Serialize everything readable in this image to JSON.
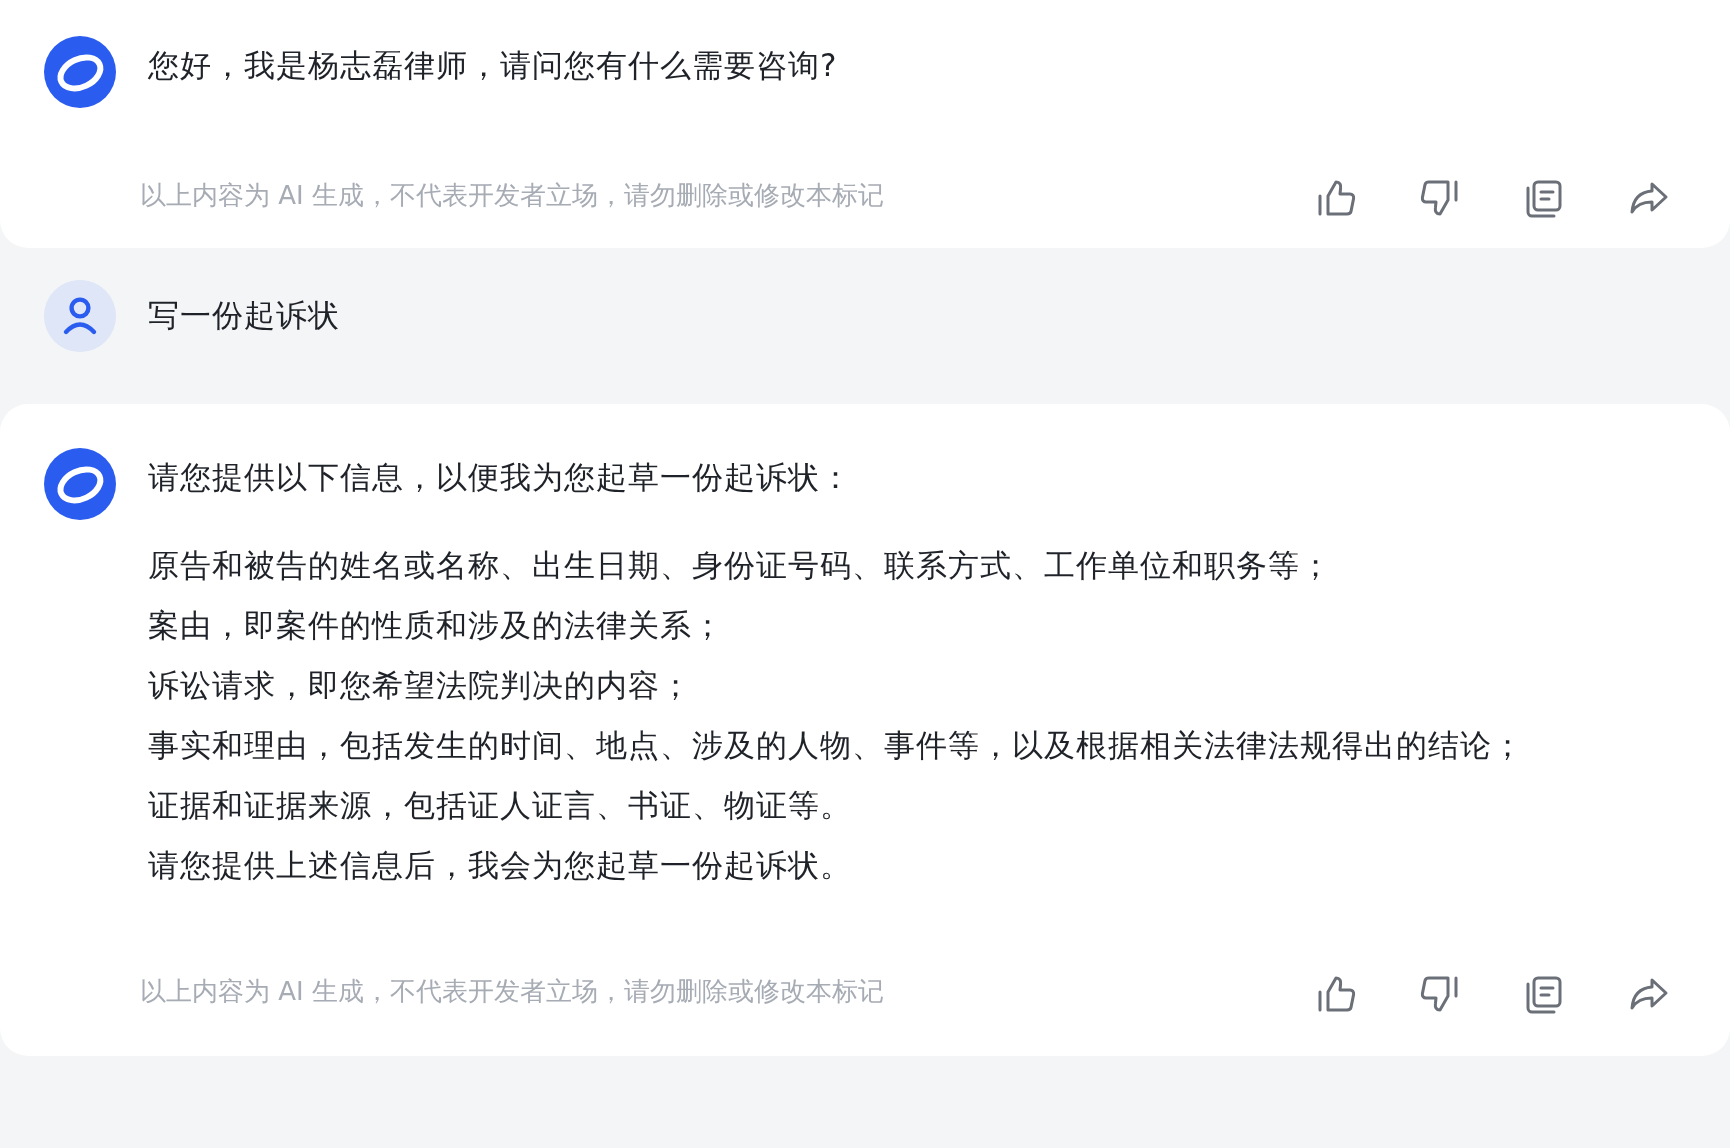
{
  "messages": [
    {
      "kind": "bot",
      "paragraphs": [
        [
          "您好，我是杨志磊律师，请问您有什么需要咨询?"
        ]
      ],
      "disclaimer": "以上内容为 AI 生成，不代表开发者立场，请勿删除或修改本标记"
    },
    {
      "kind": "user",
      "text": "写一份起诉状"
    },
    {
      "kind": "bot",
      "paragraphs": [
        [
          "请您提供以下信息，以便我为您起草一份起诉状："
        ],
        [
          "原告和被告的姓名或名称、出生日期、身份证号码、联系方式、工作单位和职务等；",
          "案由，即案件的性质和涉及的法律关系；",
          "诉讼请求，即您希望法院判决的内容；",
          "事实和理由，包括发生的时间、地点、涉及的人物、事件等，以及根据相关法律法规得出的结论；",
          "证据和证据来源，包括证人证言、书证、物证等。",
          "请您提供上述信息后，我会为您起草一份起诉状。"
        ]
      ],
      "disclaimer": "以上内容为 AI 生成，不代表开发者立场，请勿删除或修改本标记"
    }
  ]
}
